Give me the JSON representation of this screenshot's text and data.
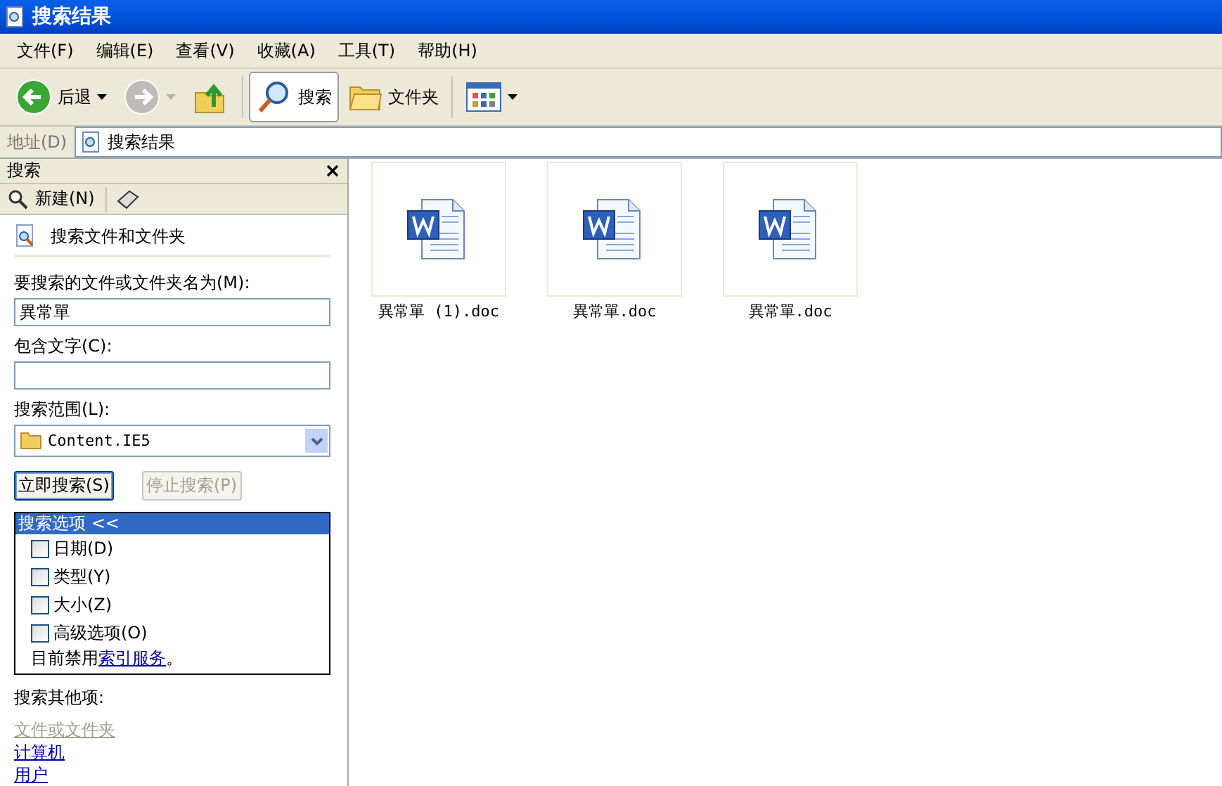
{
  "window": {
    "title": "搜索结果"
  },
  "menu": [
    {
      "label": "文件(F)"
    },
    {
      "label": "编辑(E)"
    },
    {
      "label": "查看(V)"
    },
    {
      "label": "收藏(A)"
    },
    {
      "label": "工具(T)"
    },
    {
      "label": "帮助(H)"
    }
  ],
  "toolbar": [
    {
      "kind": "back",
      "label": "后退",
      "disabled": false,
      "selected": false
    },
    {
      "kind": "forward",
      "disabled": true,
      "selected": false
    },
    {
      "kind": "up",
      "disabled": false,
      "selected": false
    },
    {
      "kind": "search",
      "label": "搜索",
      "disabled": false,
      "selected": true
    },
    {
      "kind": "folders",
      "label": "文件夹",
      "disabled": false,
      "selected": false
    },
    {
      "kind": "views",
      "disabled": false,
      "selected": false
    }
  ],
  "address": {
    "label": "地址(D)",
    "value": "搜索结果"
  },
  "search_pane": {
    "title": "搜索",
    "new_label": "新建(N)",
    "heading": "搜索文件和文件夹",
    "name_field": {
      "label": "要搜索的文件或文件夹名为(M):",
      "value": "異常單"
    },
    "text_field": {
      "label": "包含文字(C):"
    },
    "scope": {
      "label": "搜索范围(L):",
      "value": "Content.IE5"
    },
    "buttons": [
      {
        "label": "立即搜索(S)",
        "disabled": false
      },
      {
        "label": "停止搜索(P)",
        "disabled": true
      }
    ],
    "options": {
      "title": "搜索选项",
      "toggle": "<<",
      "items": [
        {
          "label": "日期(D)",
          "checked": false
        },
        {
          "label": "类型(Y)",
          "checked": false
        },
        {
          "label": "大小(Z)",
          "checked": false
        },
        {
          "label": "高级选项(O)",
          "checked": false
        }
      ],
      "note": "目前禁用",
      "note_link": "索引服务",
      "note_end": "。"
    },
    "other": {
      "title": "搜索其他项:",
      "links": [
        {
          "label": "文件或文件夹",
          "disabled": true
        },
        {
          "label": "计算机",
          "disabled": false
        },
        {
          "label": "用户",
          "disabled": false
        }
      ]
    }
  },
  "files": [
    {
      "name": "異常單 (1).doc"
    },
    {
      "name": "異常單.doc"
    },
    {
      "name": "異常單.doc"
    }
  ]
}
